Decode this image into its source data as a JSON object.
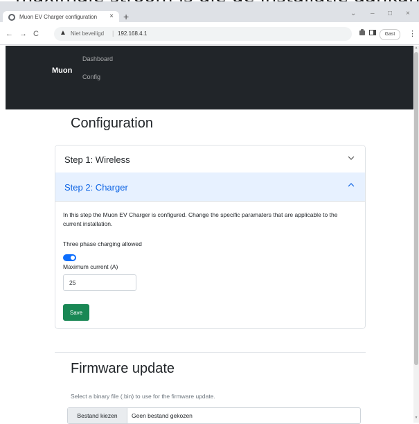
{
  "browser": {
    "tab_title": "Muon EV Charger configuration",
    "tab_close": "×",
    "new_tab": "+",
    "win_minimize": "–",
    "win_maximize": "□",
    "win_close": "×",
    "win_chevron": "⌄",
    "back": "←",
    "forward": "→",
    "reload": "C",
    "warning_icon": "▲",
    "insecure_label": "Niet beveiligd",
    "address_sep": "|",
    "url": "192.168.4.1",
    "profile_label": "Gast",
    "menu": "⋮"
  },
  "cropped_top_text": "maximale stroom is die de installatie aankan",
  "navbar": {
    "brand": "Muon",
    "links": [
      "Dashboard",
      "Config"
    ]
  },
  "config": {
    "heading": "Configuration",
    "step1_label": "Step 1: Wireless",
    "step2_label": "Step 2: Charger",
    "description": "In this step the Muon EV Charger is configured. Change the specific paramaters that are applicable to the current installation.",
    "three_phase_label": "Three phase charging allowed",
    "three_phase_enabled": true,
    "max_current_label": "Maximum current (A)",
    "max_current_value": "25",
    "save_label": "Save"
  },
  "firmware": {
    "heading": "Firmware update",
    "description": "Select a binary file (.bin) to use for the firmware update.",
    "choose_file_label": "Bestand kiezen",
    "no_file_label": "Geen bestand gekozen"
  },
  "colors": {
    "navbar_bg": "#212529",
    "accordion_active_bg": "#e7f1ff",
    "accordion_active_text": "#0c63e4",
    "toggle_on": "#0d6efd",
    "save_button": "#198754"
  }
}
